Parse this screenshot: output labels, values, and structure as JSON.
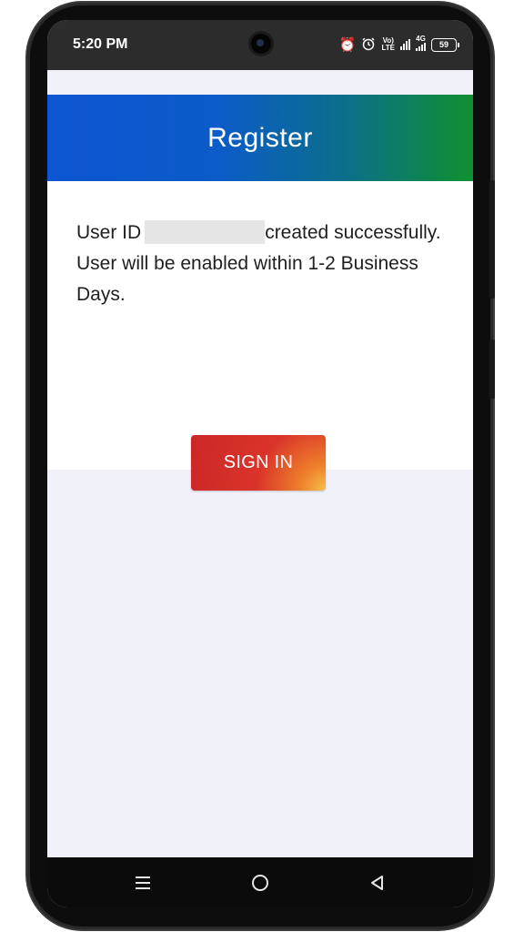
{
  "status_bar": {
    "time": "5:20 PM",
    "volte_label_top": "Vo)",
    "volte_label_bottom": "LTE",
    "network_label": "4G",
    "battery_level": "59"
  },
  "header": {
    "title": "Register"
  },
  "message": {
    "prefix": "User ID",
    "suffix": "created successfully. User will be enabled within 1-2 Business Days."
  },
  "sign_in_button": {
    "label": "SIGN IN"
  },
  "colors": {
    "header_gradient_start": "#0d55d2",
    "header_gradient_end": "#10902f",
    "button_primary": "#cc2728",
    "button_accent": "#f6c04a",
    "page_background": "#f1f1f9"
  },
  "icons": {
    "alarm": "alarm-clock-icon",
    "alarm_outline": "alarm-outline-icon",
    "signal": "signal-bars-icon",
    "battery": "battery-icon",
    "nav_menu": "menu-lines-icon",
    "nav_home": "home-circle-icon",
    "nav_back": "back-triangle-icon"
  }
}
